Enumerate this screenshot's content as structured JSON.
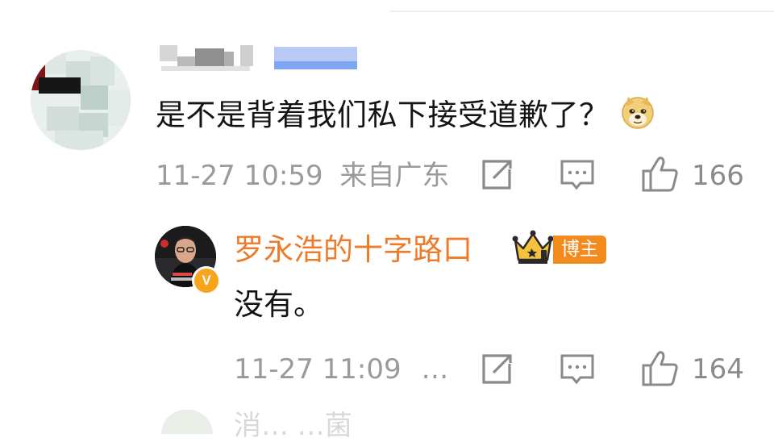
{
  "comment": {
    "text": "是不是背着我们私下接受道歉了？",
    "emoji": "doge-emoji",
    "timestamp": "11-27 10:59",
    "location": "来自广东",
    "likes": "166"
  },
  "reply": {
    "author": "罗永浩的十字路口",
    "badge": "博主",
    "verified_mark": "V",
    "text": "没有。",
    "timestamp": "11-27 11:09",
    "ellipsis": "…",
    "likes": "164"
  },
  "next_comment": {
    "name_fragment": "消…  …菌"
  },
  "colors": {
    "author_orange": "#ef7a2a",
    "badge_orange": "#f28a1e",
    "verified_yellow": "#f7a51b",
    "meta_gray": "#9a9a9a",
    "icon_gray": "#8a8a8a"
  }
}
